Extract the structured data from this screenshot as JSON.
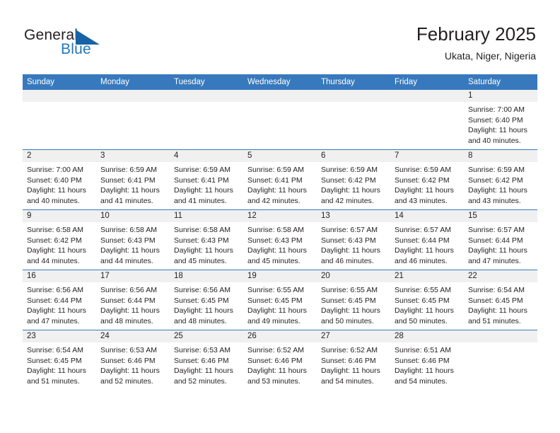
{
  "brand": {
    "name_part1": "General",
    "name_part2": "Blue",
    "logo_icon": "blue-triangle-flag-icon",
    "accent_color": "#1f77b8"
  },
  "header": {
    "title": "February 2025",
    "subtitle": "Ukata, Niger, Nigeria"
  },
  "colors": {
    "header_row_bg": "#3879bd",
    "daynum_band_bg": "#f0f0f0",
    "text": "#231f20",
    "cell_bg": "#ffffff"
  },
  "weekday_headers": [
    "Sunday",
    "Monday",
    "Tuesday",
    "Wednesday",
    "Thursday",
    "Friday",
    "Saturday"
  ],
  "weeks": [
    {
      "days": [
        {
          "day": "",
          "empty": true,
          "sunrise": "",
          "sunset": "",
          "daylight_line1": "",
          "daylight_line2": ""
        },
        {
          "day": "",
          "empty": true,
          "sunrise": "",
          "sunset": "",
          "daylight_line1": "",
          "daylight_line2": ""
        },
        {
          "day": "",
          "empty": true,
          "sunrise": "",
          "sunset": "",
          "daylight_line1": "",
          "daylight_line2": ""
        },
        {
          "day": "",
          "empty": true,
          "sunrise": "",
          "sunset": "",
          "daylight_line1": "",
          "daylight_line2": ""
        },
        {
          "day": "",
          "empty": true,
          "sunrise": "",
          "sunset": "",
          "daylight_line1": "",
          "daylight_line2": ""
        },
        {
          "day": "",
          "empty": true,
          "sunrise": "",
          "sunset": "",
          "daylight_line1": "",
          "daylight_line2": ""
        },
        {
          "day": "1",
          "empty": false,
          "sunrise": "Sunrise: 7:00 AM",
          "sunset": "Sunset: 6:40 PM",
          "daylight_line1": "Daylight: 11 hours",
          "daylight_line2": "and 40 minutes."
        }
      ]
    },
    {
      "days": [
        {
          "day": "2",
          "empty": false,
          "sunrise": "Sunrise: 7:00 AM",
          "sunset": "Sunset: 6:40 PM",
          "daylight_line1": "Daylight: 11 hours",
          "daylight_line2": "and 40 minutes."
        },
        {
          "day": "3",
          "empty": false,
          "sunrise": "Sunrise: 6:59 AM",
          "sunset": "Sunset: 6:41 PM",
          "daylight_line1": "Daylight: 11 hours",
          "daylight_line2": "and 41 minutes."
        },
        {
          "day": "4",
          "empty": false,
          "sunrise": "Sunrise: 6:59 AM",
          "sunset": "Sunset: 6:41 PM",
          "daylight_line1": "Daylight: 11 hours",
          "daylight_line2": "and 41 minutes."
        },
        {
          "day": "5",
          "empty": false,
          "sunrise": "Sunrise: 6:59 AM",
          "sunset": "Sunset: 6:41 PM",
          "daylight_line1": "Daylight: 11 hours",
          "daylight_line2": "and 42 minutes."
        },
        {
          "day": "6",
          "empty": false,
          "sunrise": "Sunrise: 6:59 AM",
          "sunset": "Sunset: 6:42 PM",
          "daylight_line1": "Daylight: 11 hours",
          "daylight_line2": "and 42 minutes."
        },
        {
          "day": "7",
          "empty": false,
          "sunrise": "Sunrise: 6:59 AM",
          "sunset": "Sunset: 6:42 PM",
          "daylight_line1": "Daylight: 11 hours",
          "daylight_line2": "and 43 minutes."
        },
        {
          "day": "8",
          "empty": false,
          "sunrise": "Sunrise: 6:59 AM",
          "sunset": "Sunset: 6:42 PM",
          "daylight_line1": "Daylight: 11 hours",
          "daylight_line2": "and 43 minutes."
        }
      ]
    },
    {
      "days": [
        {
          "day": "9",
          "empty": false,
          "sunrise": "Sunrise: 6:58 AM",
          "sunset": "Sunset: 6:42 PM",
          "daylight_line1": "Daylight: 11 hours",
          "daylight_line2": "and 44 minutes."
        },
        {
          "day": "10",
          "empty": false,
          "sunrise": "Sunrise: 6:58 AM",
          "sunset": "Sunset: 6:43 PM",
          "daylight_line1": "Daylight: 11 hours",
          "daylight_line2": "and 44 minutes."
        },
        {
          "day": "11",
          "empty": false,
          "sunrise": "Sunrise: 6:58 AM",
          "sunset": "Sunset: 6:43 PM",
          "daylight_line1": "Daylight: 11 hours",
          "daylight_line2": "and 45 minutes."
        },
        {
          "day": "12",
          "empty": false,
          "sunrise": "Sunrise: 6:58 AM",
          "sunset": "Sunset: 6:43 PM",
          "daylight_line1": "Daylight: 11 hours",
          "daylight_line2": "and 45 minutes."
        },
        {
          "day": "13",
          "empty": false,
          "sunrise": "Sunrise: 6:57 AM",
          "sunset": "Sunset: 6:43 PM",
          "daylight_line1": "Daylight: 11 hours",
          "daylight_line2": "and 46 minutes."
        },
        {
          "day": "14",
          "empty": false,
          "sunrise": "Sunrise: 6:57 AM",
          "sunset": "Sunset: 6:44 PM",
          "daylight_line1": "Daylight: 11 hours",
          "daylight_line2": "and 46 minutes."
        },
        {
          "day": "15",
          "empty": false,
          "sunrise": "Sunrise: 6:57 AM",
          "sunset": "Sunset: 6:44 PM",
          "daylight_line1": "Daylight: 11 hours",
          "daylight_line2": "and 47 minutes."
        }
      ]
    },
    {
      "days": [
        {
          "day": "16",
          "empty": false,
          "sunrise": "Sunrise: 6:56 AM",
          "sunset": "Sunset: 6:44 PM",
          "daylight_line1": "Daylight: 11 hours",
          "daylight_line2": "and 47 minutes."
        },
        {
          "day": "17",
          "empty": false,
          "sunrise": "Sunrise: 6:56 AM",
          "sunset": "Sunset: 6:44 PM",
          "daylight_line1": "Daylight: 11 hours",
          "daylight_line2": "and 48 minutes."
        },
        {
          "day": "18",
          "empty": false,
          "sunrise": "Sunrise: 6:56 AM",
          "sunset": "Sunset: 6:45 PM",
          "daylight_line1": "Daylight: 11 hours",
          "daylight_line2": "and 48 minutes."
        },
        {
          "day": "19",
          "empty": false,
          "sunrise": "Sunrise: 6:55 AM",
          "sunset": "Sunset: 6:45 PM",
          "daylight_line1": "Daylight: 11 hours",
          "daylight_line2": "and 49 minutes."
        },
        {
          "day": "20",
          "empty": false,
          "sunrise": "Sunrise: 6:55 AM",
          "sunset": "Sunset: 6:45 PM",
          "daylight_line1": "Daylight: 11 hours",
          "daylight_line2": "and 50 minutes."
        },
        {
          "day": "21",
          "empty": false,
          "sunrise": "Sunrise: 6:55 AM",
          "sunset": "Sunset: 6:45 PM",
          "daylight_line1": "Daylight: 11 hours",
          "daylight_line2": "and 50 minutes."
        },
        {
          "day": "22",
          "empty": false,
          "sunrise": "Sunrise: 6:54 AM",
          "sunset": "Sunset: 6:45 PM",
          "daylight_line1": "Daylight: 11 hours",
          "daylight_line2": "and 51 minutes."
        }
      ]
    },
    {
      "days": [
        {
          "day": "23",
          "empty": false,
          "sunrise": "Sunrise: 6:54 AM",
          "sunset": "Sunset: 6:45 PM",
          "daylight_line1": "Daylight: 11 hours",
          "daylight_line2": "and 51 minutes."
        },
        {
          "day": "24",
          "empty": false,
          "sunrise": "Sunrise: 6:53 AM",
          "sunset": "Sunset: 6:46 PM",
          "daylight_line1": "Daylight: 11 hours",
          "daylight_line2": "and 52 minutes."
        },
        {
          "day": "25",
          "empty": false,
          "sunrise": "Sunrise: 6:53 AM",
          "sunset": "Sunset: 6:46 PM",
          "daylight_line1": "Daylight: 11 hours",
          "daylight_line2": "and 52 minutes."
        },
        {
          "day": "26",
          "empty": false,
          "sunrise": "Sunrise: 6:52 AM",
          "sunset": "Sunset: 6:46 PM",
          "daylight_line1": "Daylight: 11 hours",
          "daylight_line2": "and 53 minutes."
        },
        {
          "day": "27",
          "empty": false,
          "sunrise": "Sunrise: 6:52 AM",
          "sunset": "Sunset: 6:46 PM",
          "daylight_line1": "Daylight: 11 hours",
          "daylight_line2": "and 54 minutes."
        },
        {
          "day": "28",
          "empty": false,
          "sunrise": "Sunrise: 6:51 AM",
          "sunset": "Sunset: 6:46 PM",
          "daylight_line1": "Daylight: 11 hours",
          "daylight_line2": "and 54 minutes."
        },
        {
          "day": "",
          "empty": true,
          "sunrise": "",
          "sunset": "",
          "daylight_line1": "",
          "daylight_line2": ""
        }
      ]
    }
  ]
}
